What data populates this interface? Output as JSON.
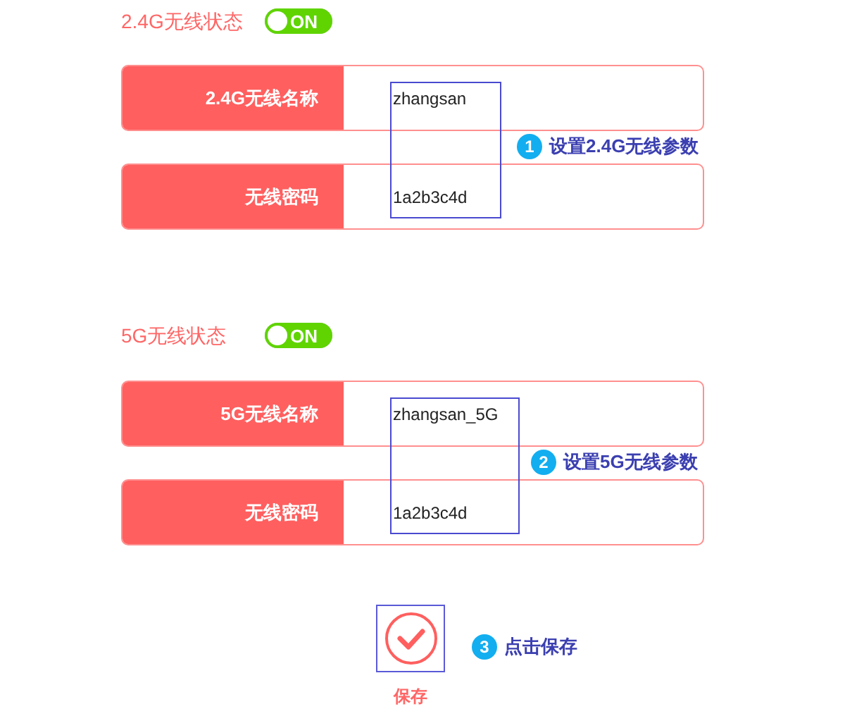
{
  "sections": [
    {
      "status_label": "2.4G无线状态",
      "toggle": {
        "on": true,
        "label": "ON"
      },
      "fields": [
        {
          "label": "2.4G无线名称",
          "value": "zhangsan"
        },
        {
          "label": "无线密码",
          "value": "1a2b3c4d"
        }
      ],
      "callout": {
        "number": "1",
        "text": "设置2.4G无线参数"
      }
    },
    {
      "status_label": "5G无线状态",
      "toggle": {
        "on": true,
        "label": "ON"
      },
      "fields": [
        {
          "label": "5G无线名称",
          "value": "zhangsan_5G"
        },
        {
          "label": "无线密码",
          "value": "1a2b3c4d"
        }
      ],
      "callout": {
        "number": "2",
        "text": "设置5G无线参数"
      }
    }
  ],
  "save": {
    "label": "保存",
    "callout": {
      "number": "3",
      "text": "点击保存"
    }
  }
}
